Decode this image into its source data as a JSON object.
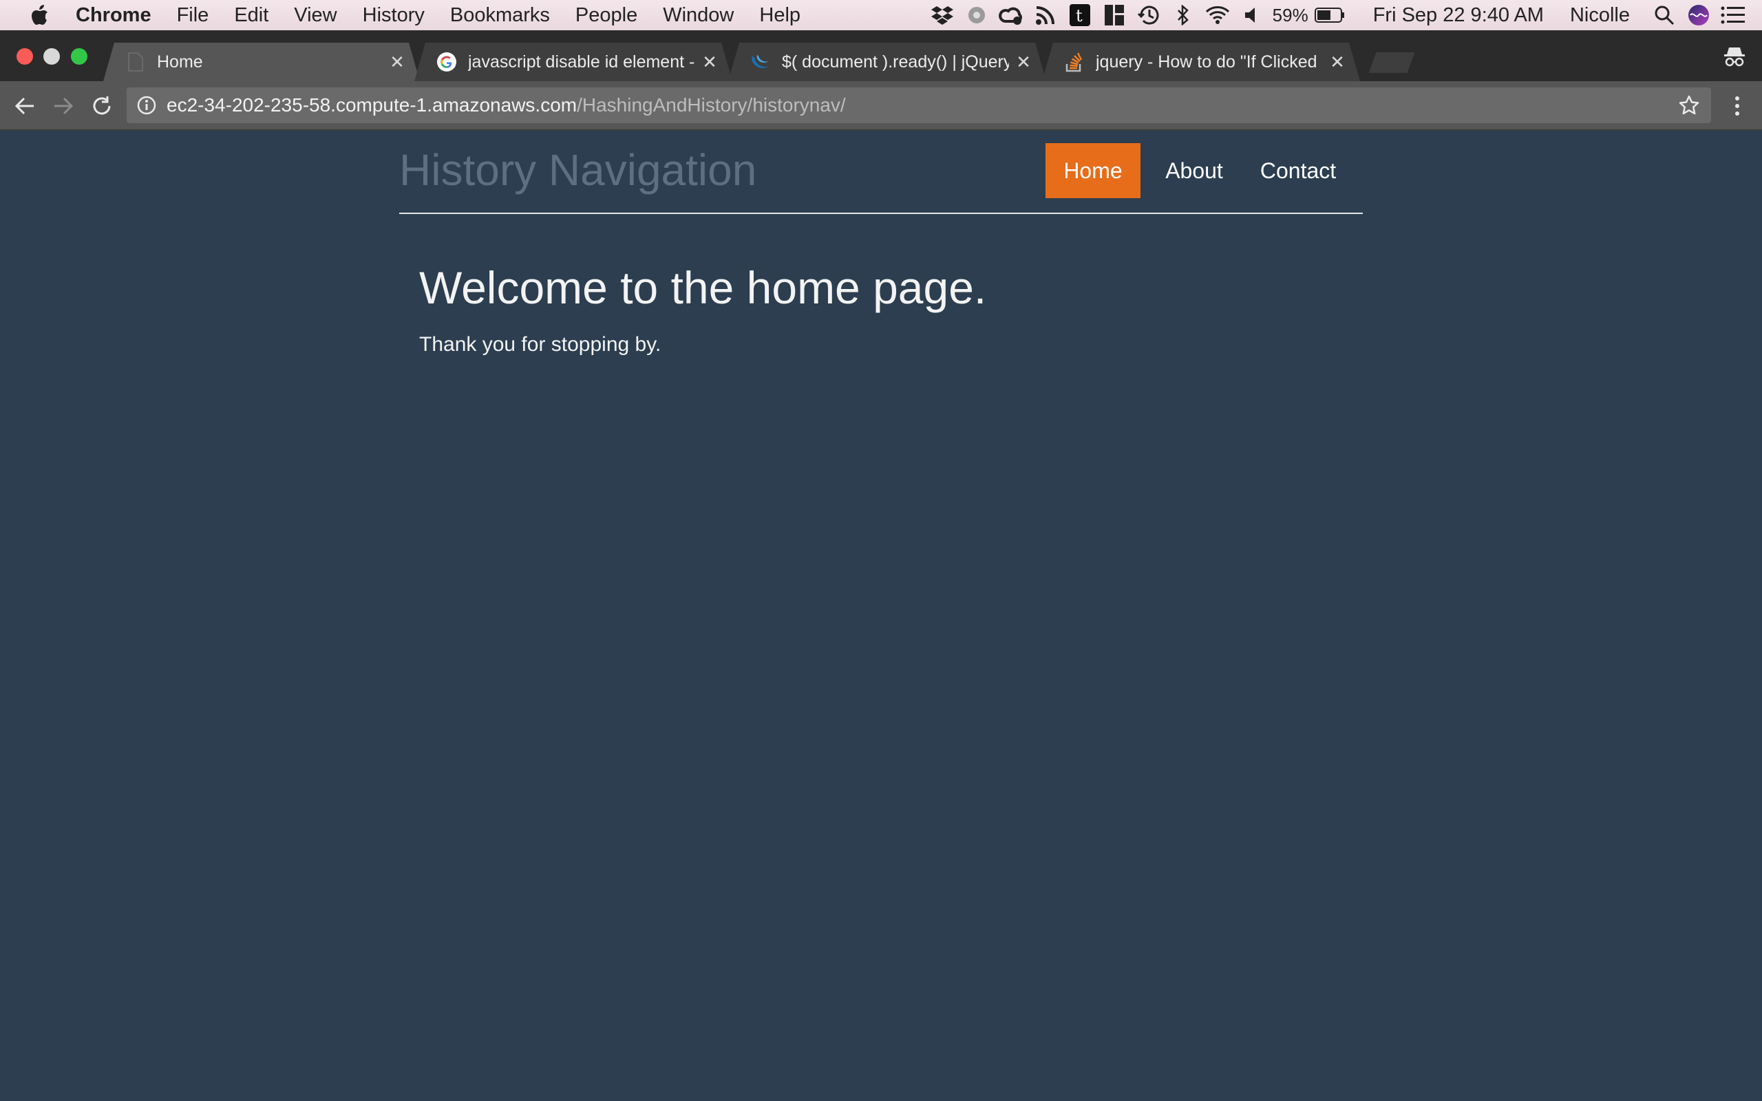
{
  "menubar": {
    "app_name": "Chrome",
    "items": [
      "File",
      "Edit",
      "View",
      "History",
      "Bookmarks",
      "People",
      "Window",
      "Help"
    ],
    "battery_percent": "59%",
    "datetime": "Fri Sep 22  9:40 AM",
    "user": "Nicolle",
    "status_icons": [
      "dropbox-icon",
      "app-icon",
      "creative-cloud-icon",
      "rss-icon",
      "t-icon",
      "split-icon",
      "time-machine-icon",
      "bluetooth-icon",
      "wifi-icon",
      "volume-icon",
      "battery-icon",
      "spotlight-icon",
      "siri-icon",
      "notification-center-icon"
    ]
  },
  "tabs": [
    {
      "title": "Home",
      "active": true
    },
    {
      "title": "javascript disable id element - ",
      "active": false
    },
    {
      "title": "$( document ).ready() | jQuery",
      "active": false
    },
    {
      "title": "jquery - How to do \"If Clicked I",
      "active": false
    }
  ],
  "toolbar": {
    "url_host": "ec2-34-202-235-58.compute-1.amazonaws.com",
    "url_path": "/HashingAndHistory/historynav/"
  },
  "page": {
    "site_title": "History Navigation",
    "nav": [
      {
        "label": "Home",
        "active": true
      },
      {
        "label": "About",
        "active": false
      },
      {
        "label": "Contact",
        "active": false
      }
    ],
    "heading": "Welcome to the home page.",
    "subtext": "Thank you for stopping by."
  },
  "colors": {
    "page_bg": "#2c3e50",
    "nav_active": "#e76d1b",
    "site_title": "#5c6f83"
  }
}
